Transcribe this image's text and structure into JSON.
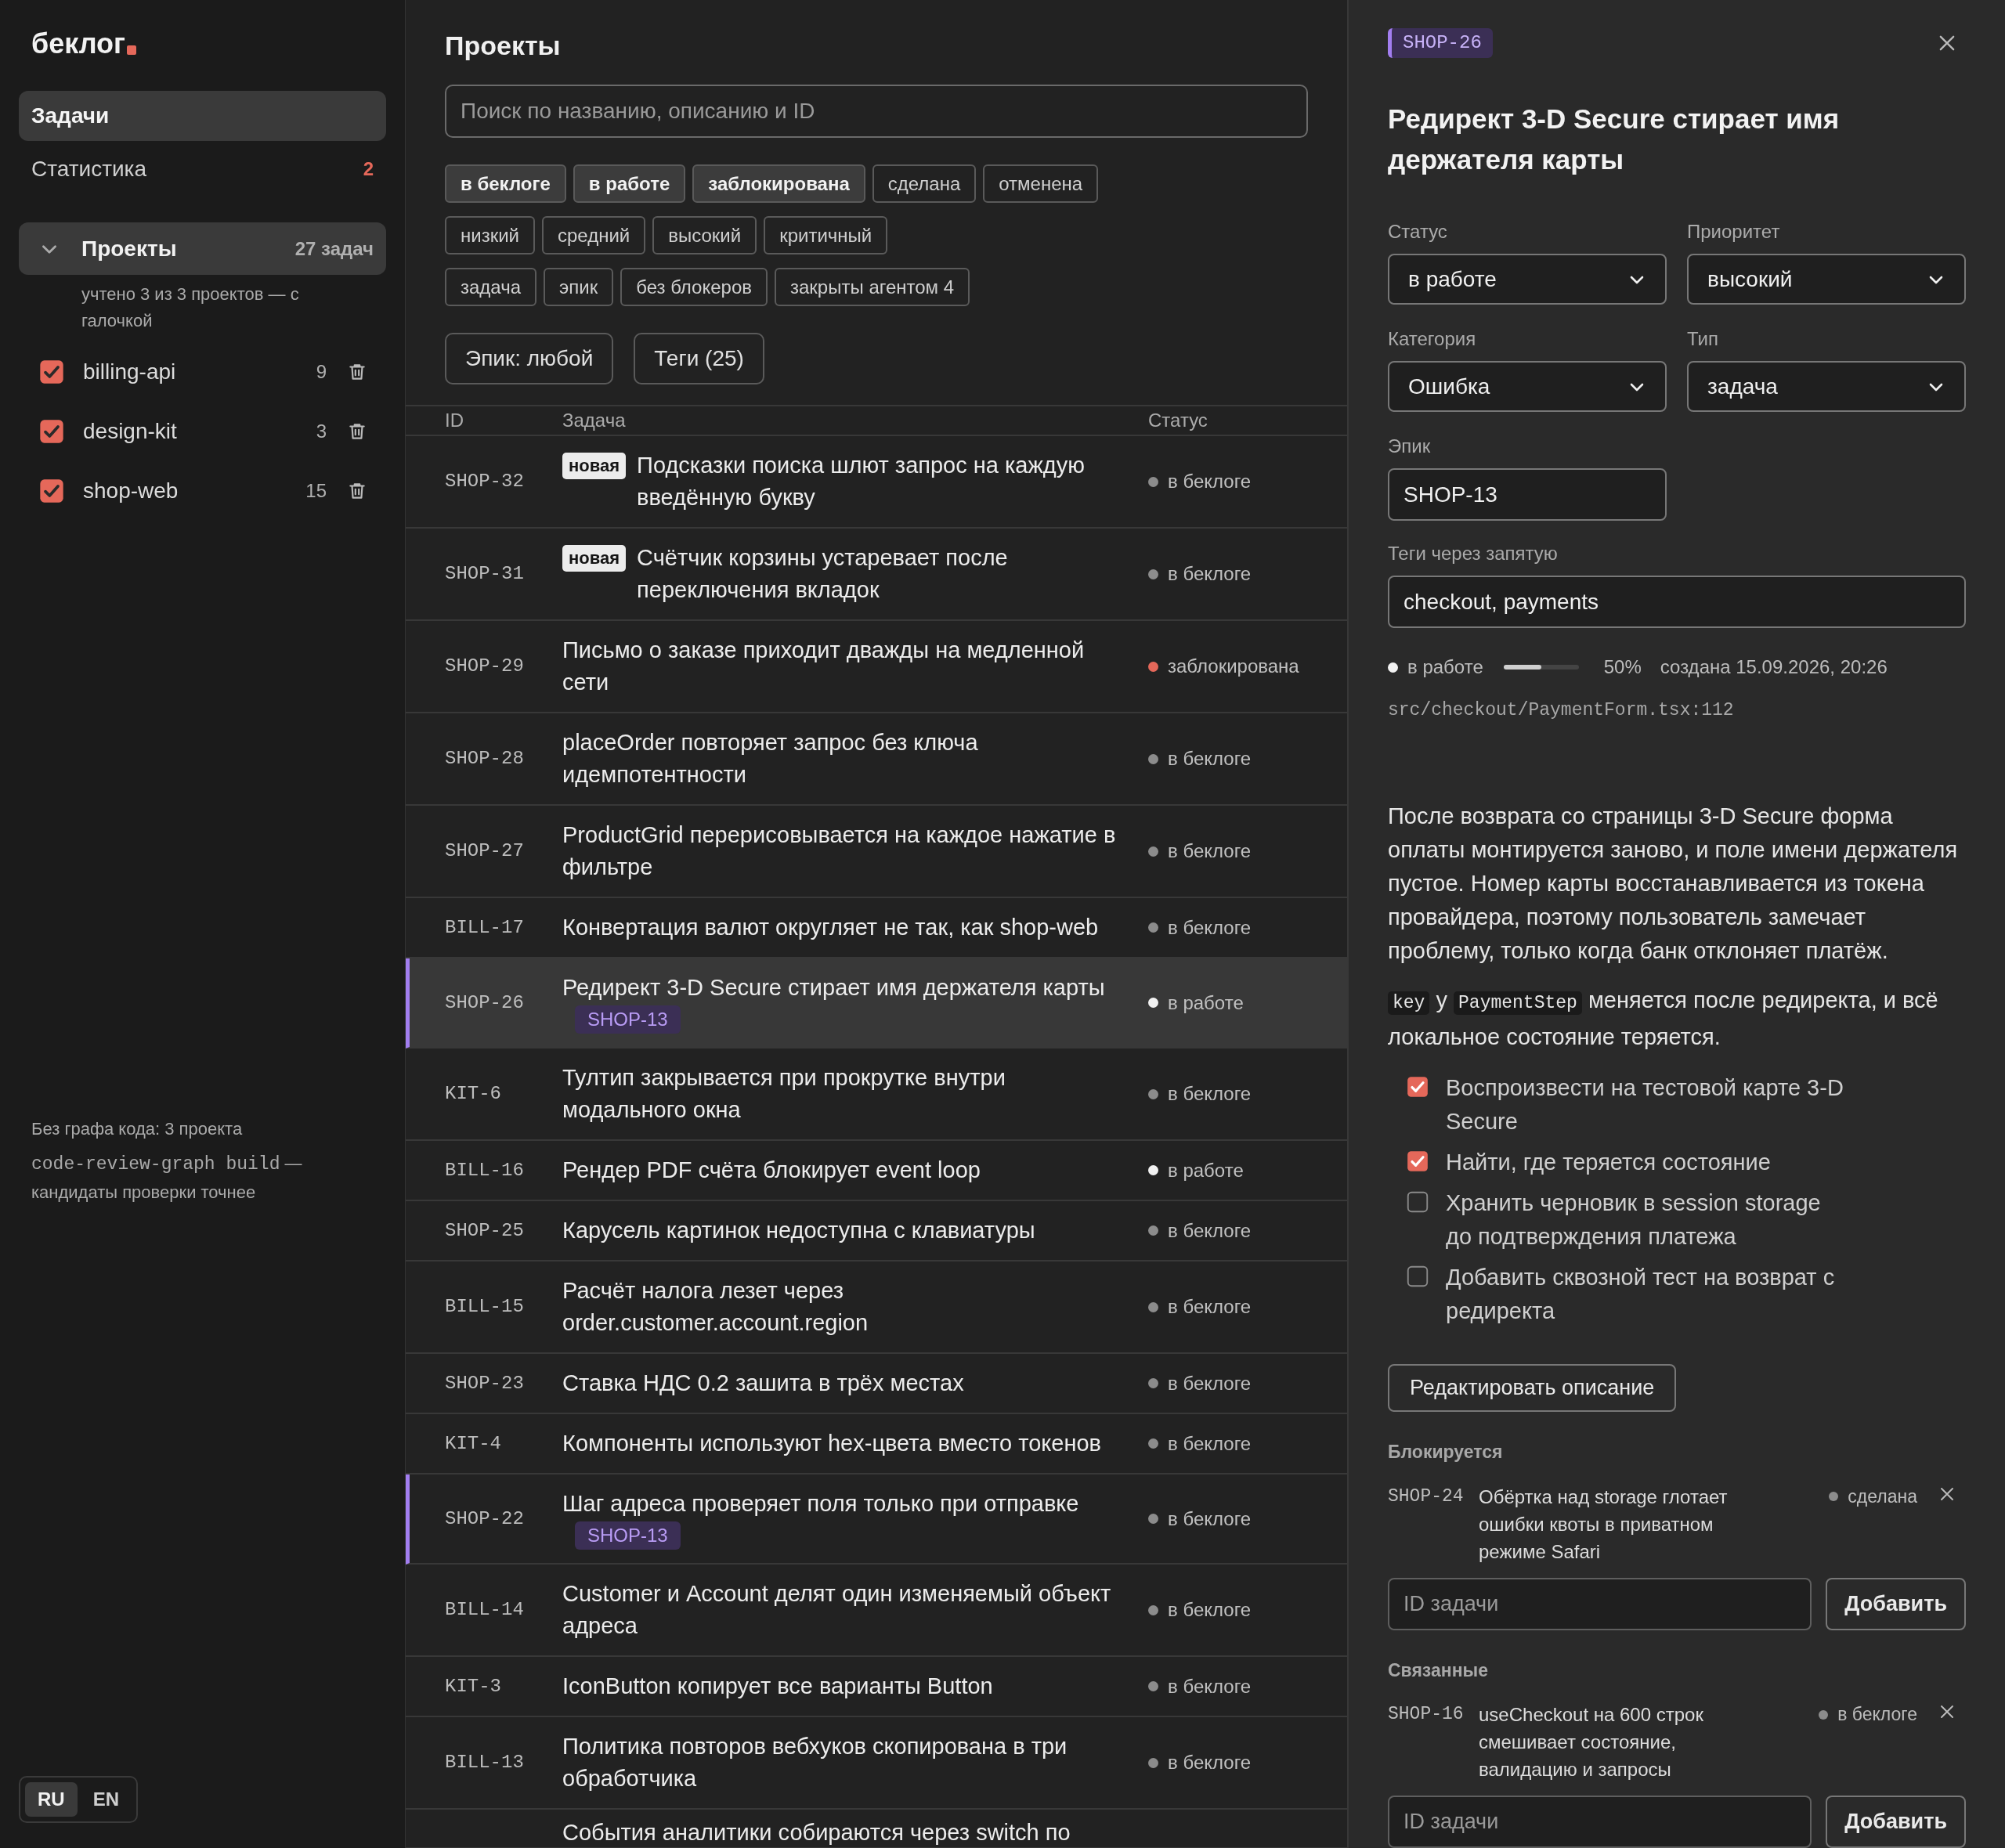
{
  "sidebar": {
    "logo": "беклог",
    "nav": [
      {
        "label": "Задачи",
        "selected": true
      },
      {
        "label": "Статистика",
        "selected": false,
        "badge": "2"
      }
    ],
    "projects_group": {
      "label": "Проекты",
      "count": "27 задач",
      "expanded": true,
      "note": "учтено 3 из 3 проектов — с галочкой",
      "items": [
        {
          "name": "billing-api",
          "count": "9",
          "checked": true
        },
        {
          "name": "design-kit",
          "count": "3",
          "checked": true
        },
        {
          "name": "shop-web",
          "count": "15",
          "checked": true
        }
      ]
    },
    "graph_note": {
      "title": "Без графа кода: 3 проекта",
      "command": "code-review-graph build",
      "text": "— кандидаты проверки точнее"
    },
    "languages": [
      {
        "label": "RU",
        "selected": true
      },
      {
        "label": "EN",
        "selected": false
      }
    ]
  },
  "main": {
    "title": "Проекты",
    "search": {
      "placeholder": "Поиск по названию, описанию и ID"
    },
    "filter_rows": [
      [
        {
          "label": "в беклоге",
          "selected": true
        },
        {
          "label": "в работе",
          "selected": true
        },
        {
          "label": "заблокирована",
          "selected": true
        },
        {
          "label": "сделана",
          "selected": false
        },
        {
          "label": "отменена",
          "selected": false
        }
      ],
      [
        {
          "label": "низкий",
          "selected": false
        },
        {
          "label": "средний",
          "selected": false
        },
        {
          "label": "высокий",
          "selected": false
        },
        {
          "label": "критичный",
          "selected": false
        }
      ],
      [
        {
          "label": "задача",
          "selected": false
        },
        {
          "label": "эпик",
          "selected": false
        },
        {
          "label": "без блокеров",
          "selected": false
        },
        {
          "label": "закрыты агентом 4",
          "selected": false
        }
      ]
    ],
    "dropdown_buttons": [
      "Эпик: любой",
      "Теги (25)"
    ],
    "table": {
      "columns": [
        "ID",
        "Задача",
        "Статус"
      ],
      "rows": [
        {
          "kind": "task",
          "id": "SHOP-32",
          "badge": "новая",
          "title": "Подсказки поиска шлют запрос на каждую введённую букву",
          "status": "в беклоге",
          "color": "#8c8c8c",
          "selected": false
        },
        {
          "kind": "task",
          "id": "SHOP-31",
          "badge": "новая",
          "title": "Счётчик корзины устаревает после переключения вкладок",
          "status": "в беклоге",
          "color": "#8c8c8c",
          "selected": false
        },
        {
          "kind": "task",
          "id": "SHOP-29",
          "title": "Письмо о заказе приходит дважды на медленной сети",
          "status": "заблокирована",
          "color": "#e5685a",
          "selected": false
        },
        {
          "kind": "task",
          "id": "SHOP-28",
          "title": "placeOrder повторяет запрос без ключа идемпотентности",
          "status": "в беклоге",
          "color": "#8c8c8c",
          "selected": false
        },
        {
          "kind": "task",
          "id": "SHOP-27",
          "title": "ProductGrid перерисовывается на каждое нажатие в фильтре",
          "status": "в беклоге",
          "color": "#8c8c8c",
          "selected": false
        },
        {
          "kind": "task",
          "id": "BILL-17",
          "title": "Конвертация валют округляет не так, как shop-web",
          "status": "в беклоге",
          "color": "#8c8c8c",
          "selected": false
        },
        {
          "kind": "task",
          "id": "SHOP-26",
          "title": "Редирект 3-D Secure стирает имя держателя карты",
          "epic": "SHOP-13",
          "status": "в работе",
          "color": "#f2f2f2",
          "selected": true
        },
        {
          "kind": "task",
          "id": "KIT-6",
          "title": "Тултип закрывается при прокрутке внутри модального окна",
          "status": "в беклоге",
          "color": "#8c8c8c",
          "selected": false
        },
        {
          "kind": "task",
          "id": "BILL-16",
          "title": "Рендер PDF счёта блокирует event loop",
          "status": "в работе",
          "color": "#f2f2f2",
          "selected": false
        },
        {
          "kind": "task",
          "id": "SHOP-25",
          "title": "Карусель картинок недоступна с клавиатуры",
          "status": "в беклоге",
          "color": "#8c8c8c",
          "selected": false
        },
        {
          "kind": "task",
          "id": "BILL-15",
          "title": "Расчёт налога лезет через order.customer.account.region",
          "status": "в беклоге",
          "color": "#8c8c8c",
          "selected": false
        },
        {
          "kind": "task",
          "id": "SHOP-23",
          "title": "Ставка НДС 0.2 зашита в трёх местах",
          "status": "в беклоге",
          "color": "#8c8c8c",
          "selected": false
        },
        {
          "kind": "task",
          "id": "KIT-4",
          "title": "Компоненты используют hex-цвета вместо токенов",
          "status": "в беклоге",
          "color": "#8c8c8c",
          "selected": false
        },
        {
          "kind": "task",
          "id": "SHOP-22",
          "title": "Шаг адреса проверяет поля только при отправке",
          "epic": "SHOP-13",
          "status": "в беклоге",
          "color": "#8c8c8c",
          "selected": false
        },
        {
          "kind": "task",
          "id": "BILL-14",
          "title": "Customer и Account делят один изменяемый объект адреса",
          "status": "в беклоге",
          "color": "#8c8c8c",
          "selected": false
        },
        {
          "kind": "task",
          "id": "KIT-3",
          "title": "IconButton копирует все варианты Button",
          "status": "в беклоге",
          "color": "#8c8c8c",
          "selected": false
        },
        {
          "kind": "task",
          "id": "BILL-13",
          "title": "Политика повторов вебхуков скопирована в три обработчика",
          "status": "в беклоге",
          "color": "#8c8c8c",
          "selected": false
        },
        {
          "kind": "partial",
          "title": "События аналитики собираются через switch по"
        }
      ]
    }
  },
  "detail": {
    "id": "SHOP-26",
    "title": "Редирект 3-D Secure стирает имя держателя карты",
    "fields": [
      {
        "kind": "select",
        "label": "Статус",
        "value": "в работе"
      },
      {
        "kind": "select",
        "label": "Приоритет",
        "value": "высокий"
      },
      {
        "kind": "select",
        "label": "Категория",
        "value": "Ошибка"
      },
      {
        "kind": "select",
        "label": "Тип",
        "value": "задача"
      },
      {
        "kind": "input",
        "label": "Эпик",
        "value": "SHOP-13"
      }
    ],
    "tags_field": {
      "label": "Теги через запятую",
      "value": "checkout, payments"
    },
    "progress": {
      "status": "в работе",
      "color": "#f2f2f2",
      "level": 0.5,
      "percent": "50%",
      "created": "создана 15.09.2026, 20:26"
    },
    "source": "src/checkout/PaymentForm.tsx:112",
    "description": "После возврата со страницы 3-D Secure форма оплаты монтируется заново, и поле имени держателя пустое. Номер карты восстанавливается из токена провайдера, поэтому пользователь замечает проблему, только когда банк отклоняет платёж.",
    "note_parts": [
      {
        "kind": "code",
        "text": "key"
      },
      {
        "kind": "text",
        "text": " у "
      },
      {
        "kind": "code",
        "text": "PaymentStep"
      },
      {
        "kind": "text",
        "text": " меняется после редиректа, и всё локальное состояние теряется."
      }
    ],
    "checklist": [
      {
        "label": "Воспроизвести на тестовой карте 3-D Secure",
        "checked": true
      },
      {
        "label": "Найти, где теряется состояние",
        "checked": true
      },
      {
        "label": "Хранить черновик в session storage до подтверждения платежа",
        "checked": false
      },
      {
        "label": "Добавить сквозной тест на возврат с редиректа",
        "checked": false
      }
    ],
    "edit_button": "Редактировать описание",
    "relations": [
      {
        "title": "Блокируется",
        "items": [
          {
            "id": "SHOP-24",
            "title": "Обёртка над storage глотает ошибки квоты в приватном режиме Safari",
            "status": "сделана",
            "color": "#8c8c8c"
          }
        ],
        "input": {
          "placeholder": "ID задачи"
        },
        "button": "Добавить"
      },
      {
        "title": "Связанные",
        "items": [
          {
            "id": "SHOP-16",
            "title": "useCheckout на 600 строк смешивает состояние, валидацию и запросы",
            "status": "в беклоге",
            "color": "#8c8c8c"
          }
        ],
        "input": {
          "placeholder": "ID задачи"
        },
        "button": "Добавить"
      }
    ]
  }
}
